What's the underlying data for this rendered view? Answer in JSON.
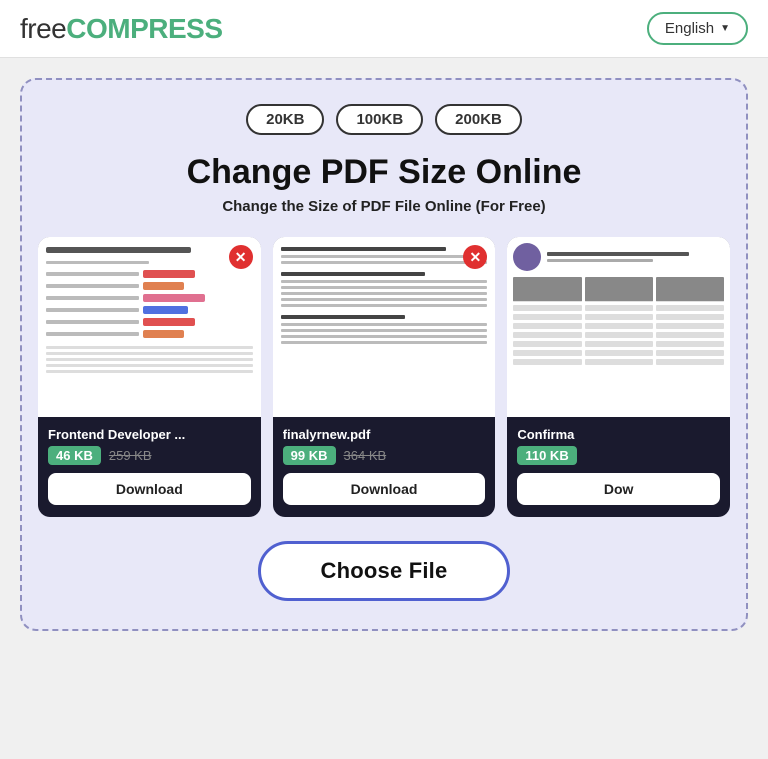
{
  "header": {
    "logo_free": "free",
    "logo_compress": "COMPRESS",
    "lang_label": "English",
    "lang_arrow": "▼"
  },
  "size_pills": [
    "20KB",
    "100KB",
    "200KB"
  ],
  "main_title": "Change PDF Size Online",
  "sub_title": "Change the Size of PDF File Online (For Free)",
  "cards": [
    {
      "filename": "Frontend Developer ...",
      "new_size": "46 KB",
      "old_size": "259 KB",
      "download_label": "Download",
      "close_label": "✕"
    },
    {
      "filename": "finalyrnew.pdf",
      "new_size": "99 KB",
      "old_size": "364 KB",
      "download_label": "Download",
      "close_label": "✕"
    },
    {
      "filename": "Confirma",
      "new_size": "110 KB",
      "old_size": "",
      "download_label": "Dow",
      "close_label": "✕"
    }
  ],
  "choose_file_label": "Choose File"
}
